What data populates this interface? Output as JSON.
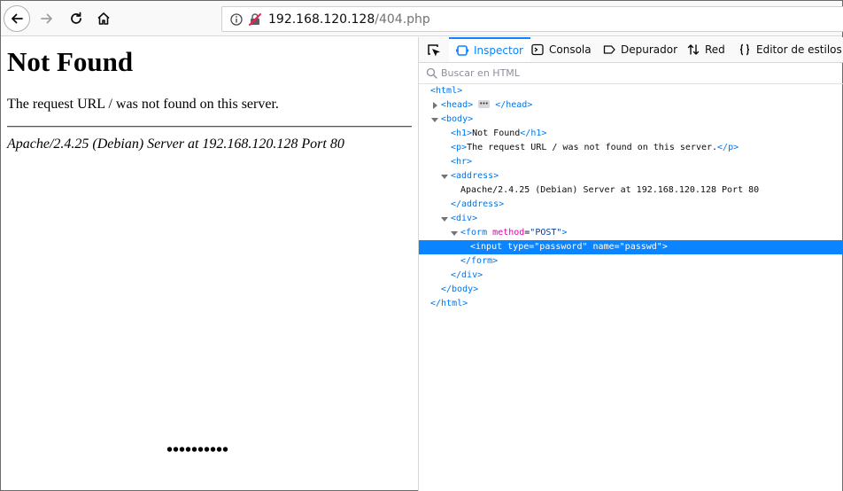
{
  "toolbar": {
    "url_host": "192.168.120.128",
    "url_path": "/404.php"
  },
  "page": {
    "title": "Not Found",
    "message": "The request URL / was not found on this server.",
    "address": "Apache/2.4.25 (Debian) Server at 192.168.120.128 Port 80",
    "password_value": "••••••••••"
  },
  "devtools": {
    "tabs": [
      {
        "label": "Inspector",
        "icon": "inspector-icon",
        "active": true
      },
      {
        "label": "Consola",
        "icon": "console-icon",
        "active": false
      },
      {
        "label": "Depurador",
        "icon": "debugger-icon",
        "active": false
      },
      {
        "label": "Red",
        "icon": "network-icon",
        "active": false
      },
      {
        "label": "Editor de estilos",
        "icon": "style-editor-icon",
        "active": false
      }
    ],
    "search_placeholder": "Buscar en HTML",
    "tree": {
      "html_open": "<html>",
      "head_open": "<head>",
      "head_close": "</head>",
      "body_open": "<body>",
      "h1_open": "<h1>",
      "h1_text": "Not Found",
      "h1_close": "</h1>",
      "p_open": "<p>",
      "p_text": "The request URL / was not found on this server.",
      "p_close": "</p>",
      "hr": "<hr>",
      "address_open": "<address>",
      "address_text": "Apache/2.4.25 (Debian) Server at 192.168.120.128 Port 80",
      "address_close": "</address>",
      "div_open": "<div>",
      "form_open_start": "<form",
      "form_attr": "method",
      "form_val": "\"POST\"",
      "form_open_end": ">",
      "input_start": "<input",
      "input_attr1": "type",
      "input_val1": "\"password\"",
      "input_attr2": "name",
      "input_val2": "\"passwd\"",
      "input_end": ">",
      "form_close": "</form>",
      "div_close": "</div>",
      "body_close": "</body>",
      "html_close": "</html>"
    }
  }
}
